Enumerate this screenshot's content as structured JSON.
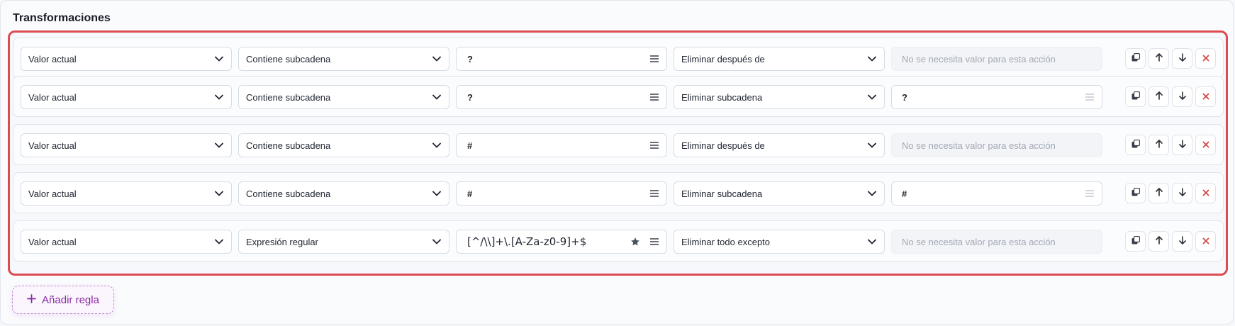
{
  "section": {
    "title": "Transformaciones"
  },
  "rules": [
    {
      "source": "Valor actual",
      "condition": "Contiene subcadena",
      "pattern": "?",
      "action": "Eliminar después de",
      "replacement": "",
      "replacement_placeholder": "No se necesita valor para esta acción"
    },
    {
      "source": "Valor actual",
      "condition": "Contiene subcadena",
      "pattern": "?",
      "action": "Eliminar subcadena",
      "replacement": "?",
      "replacement_placeholder": ""
    },
    {
      "source": "Valor actual",
      "condition": "Contiene subcadena",
      "pattern": "#",
      "action": "Eliminar después de",
      "replacement": "",
      "replacement_placeholder": "No se necesita valor para esta acción"
    },
    {
      "source": "Valor actual",
      "condition": "Contiene subcadena",
      "pattern": "#",
      "action": "Eliminar subcadena",
      "replacement": "#",
      "replacement_placeholder": ""
    },
    {
      "source": "Valor actual",
      "condition": "Expresión regular",
      "pattern": "[^/\\\\]+\\.[A-Za-z0-9]+$",
      "action": "Eliminar todo excepto",
      "replacement": "",
      "replacement_placeholder": "No se necesita valor para esta acción"
    }
  ],
  "add_rule": {
    "label": "Añadir regla"
  },
  "icons": {
    "chevron": "chevron-down-icon",
    "menu": "menu-icon",
    "star": "star-icon",
    "duplicate": "duplicate-icon",
    "up": "arrow-up-icon",
    "down": "arrow-down-icon",
    "delete": "close-icon",
    "plus": "plus-icon"
  },
  "colors": {
    "highlight_border": "#dc4a52",
    "accent": "#8a2aa3",
    "delete": "#d64545"
  }
}
